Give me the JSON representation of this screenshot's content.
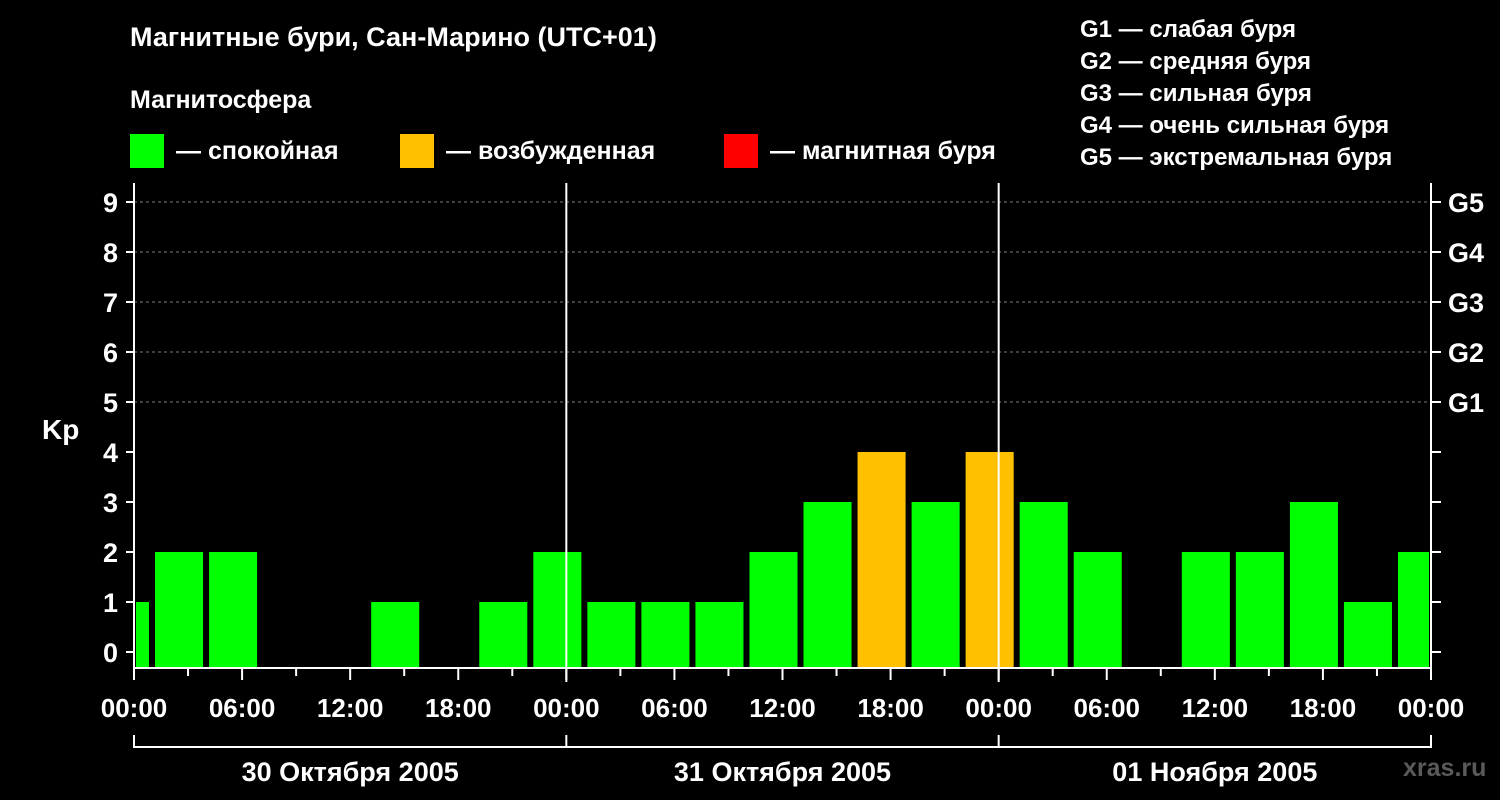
{
  "title": "Магнитные бури, Сан-Марино (UTC+01)",
  "magnetosphere_title": "Магнитосфера",
  "legend": [
    {
      "label": "— спокойная",
      "color": "#00ff00"
    },
    {
      "label": "— возбужденная",
      "color": "#ffc000"
    },
    {
      "label": "— магнитная буря",
      "color": "#ff0000"
    }
  ],
  "g_legend": [
    "G1 — слабая буря",
    "G2 — средняя буря",
    "G3 — сильная буря",
    "G4 — очень сильная буря",
    "G5 — экстремальная буря"
  ],
  "watermark": "xras.ru",
  "chart_data": {
    "type": "bar",
    "ylabel": "Kp",
    "ylim": [
      0,
      9
    ],
    "yticks": [
      "0",
      "1",
      "2",
      "3",
      "4",
      "5",
      "6",
      "7",
      "8",
      "9"
    ],
    "right_ticks": [
      {
        "value": 5,
        "label": "G1"
      },
      {
        "value": 6,
        "label": "G2"
      },
      {
        "value": 7,
        "label": "G3"
      },
      {
        "value": 8,
        "label": "G4"
      },
      {
        "value": 9,
        "label": "G5"
      }
    ],
    "xlim_hours": [
      0,
      72
    ],
    "xtick_labels": [
      "00:00",
      "06:00",
      "12:00",
      "18:00",
      "00:00",
      "06:00",
      "12:00",
      "18:00",
      "00:00",
      "06:00",
      "12:00",
      "18:00",
      "00:00"
    ],
    "date_labels": [
      "30 Октября 2005",
      "31 Октября 2005",
      "01 Ноября 2005"
    ],
    "colors": {
      "quiet": "#00ff00",
      "disturbed": "#ffc000",
      "storm": "#ff0000"
    },
    "bars": [
      {
        "start_h": 0,
        "end_h": 1,
        "value": 1,
        "level": "quiet"
      },
      {
        "start_h": 1,
        "end_h": 4,
        "value": 2,
        "level": "quiet"
      },
      {
        "start_h": 4,
        "end_h": 7,
        "value": 2,
        "level": "quiet"
      },
      {
        "start_h": 7,
        "end_h": 10,
        "value": 0,
        "level": "quiet"
      },
      {
        "start_h": 10,
        "end_h": 13,
        "value": 0,
        "level": "quiet"
      },
      {
        "start_h": 13,
        "end_h": 16,
        "value": 1,
        "level": "quiet"
      },
      {
        "start_h": 16,
        "end_h": 19,
        "value": 0,
        "level": "quiet"
      },
      {
        "start_h": 19,
        "end_h": 22,
        "value": 1,
        "level": "quiet"
      },
      {
        "start_h": 22,
        "end_h": 25,
        "value": 2,
        "level": "quiet"
      },
      {
        "start_h": 25,
        "end_h": 28,
        "value": 1,
        "level": "quiet"
      },
      {
        "start_h": 28,
        "end_h": 31,
        "value": 1,
        "level": "quiet"
      },
      {
        "start_h": 31,
        "end_h": 34,
        "value": 1,
        "level": "quiet"
      },
      {
        "start_h": 34,
        "end_h": 37,
        "value": 2,
        "level": "quiet"
      },
      {
        "start_h": 37,
        "end_h": 40,
        "value": 3,
        "level": "quiet"
      },
      {
        "start_h": 40,
        "end_h": 43,
        "value": 4,
        "level": "disturbed"
      },
      {
        "start_h": 43,
        "end_h": 46,
        "value": 3,
        "level": "quiet"
      },
      {
        "start_h": 46,
        "end_h": 49,
        "value": 4,
        "level": "disturbed"
      },
      {
        "start_h": 49,
        "end_h": 52,
        "value": 3,
        "level": "quiet"
      },
      {
        "start_h": 52,
        "end_h": 55,
        "value": 2,
        "level": "quiet"
      },
      {
        "start_h": 55,
        "end_h": 58,
        "value": 0,
        "level": "quiet"
      },
      {
        "start_h": 58,
        "end_h": 61,
        "value": 2,
        "level": "quiet"
      },
      {
        "start_h": 61,
        "end_h": 64,
        "value": 2,
        "level": "quiet"
      },
      {
        "start_h": 64,
        "end_h": 67,
        "value": 3,
        "level": "quiet"
      },
      {
        "start_h": 67,
        "end_h": 70,
        "value": 1,
        "level": "quiet"
      },
      {
        "start_h": 70,
        "end_h": 72,
        "value": 2,
        "level": "quiet"
      }
    ]
  }
}
